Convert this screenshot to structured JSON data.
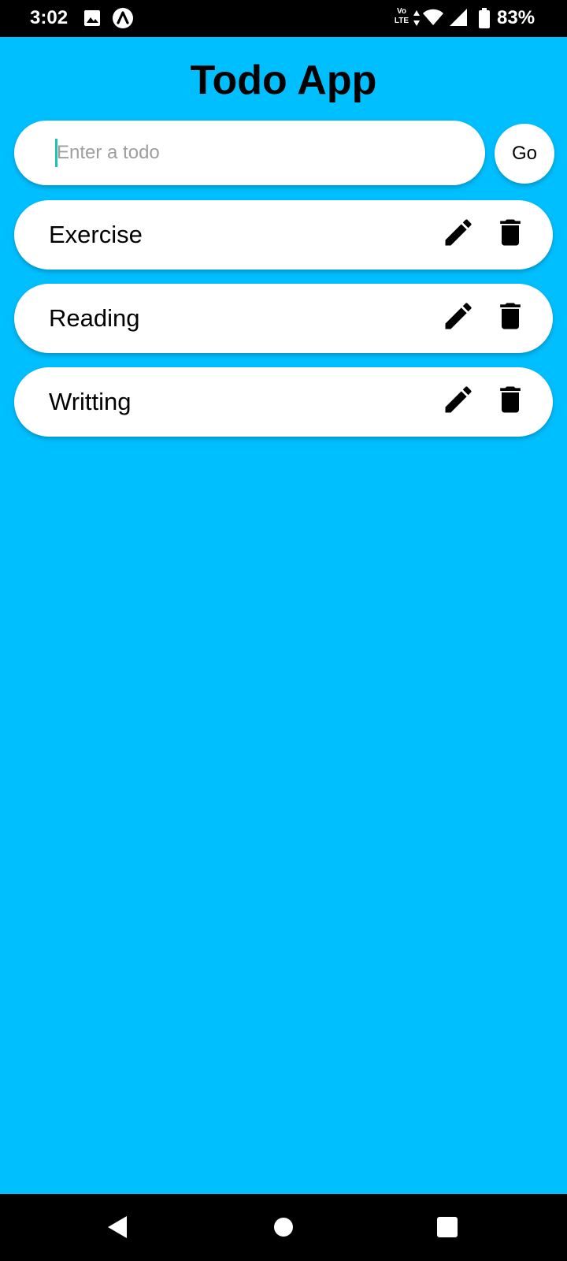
{
  "status_bar": {
    "time": "3:02",
    "network_label_top": "Vo",
    "network_label_bottom": "LTE",
    "battery_percent": "83%",
    "icons": [
      "image-icon",
      "app-notification-icon",
      "data-arrows-icon",
      "wifi-icon",
      "signal-icon",
      "battery-icon"
    ]
  },
  "app": {
    "title": "Todo App",
    "input": {
      "placeholder": "Enter a todo",
      "value": ""
    },
    "go_button_label": "Go",
    "todos": [
      {
        "text": "Exercise",
        "actions": [
          "edit-icon",
          "delete-icon"
        ]
      },
      {
        "text": "Reading",
        "actions": [
          "edit-icon",
          "delete-icon"
        ]
      },
      {
        "text": "Writting",
        "actions": [
          "edit-icon",
          "delete-icon"
        ]
      }
    ]
  },
  "nav_bar": {
    "icons": [
      "back-icon",
      "home-icon",
      "recents-icon"
    ]
  },
  "colors": {
    "background": "#00BFFF",
    "surface": "#FFFFFF",
    "text": "#000000",
    "placeholder": "#9E9E9E",
    "caret": "#1FC2B2",
    "system_bars": "#000000"
  }
}
